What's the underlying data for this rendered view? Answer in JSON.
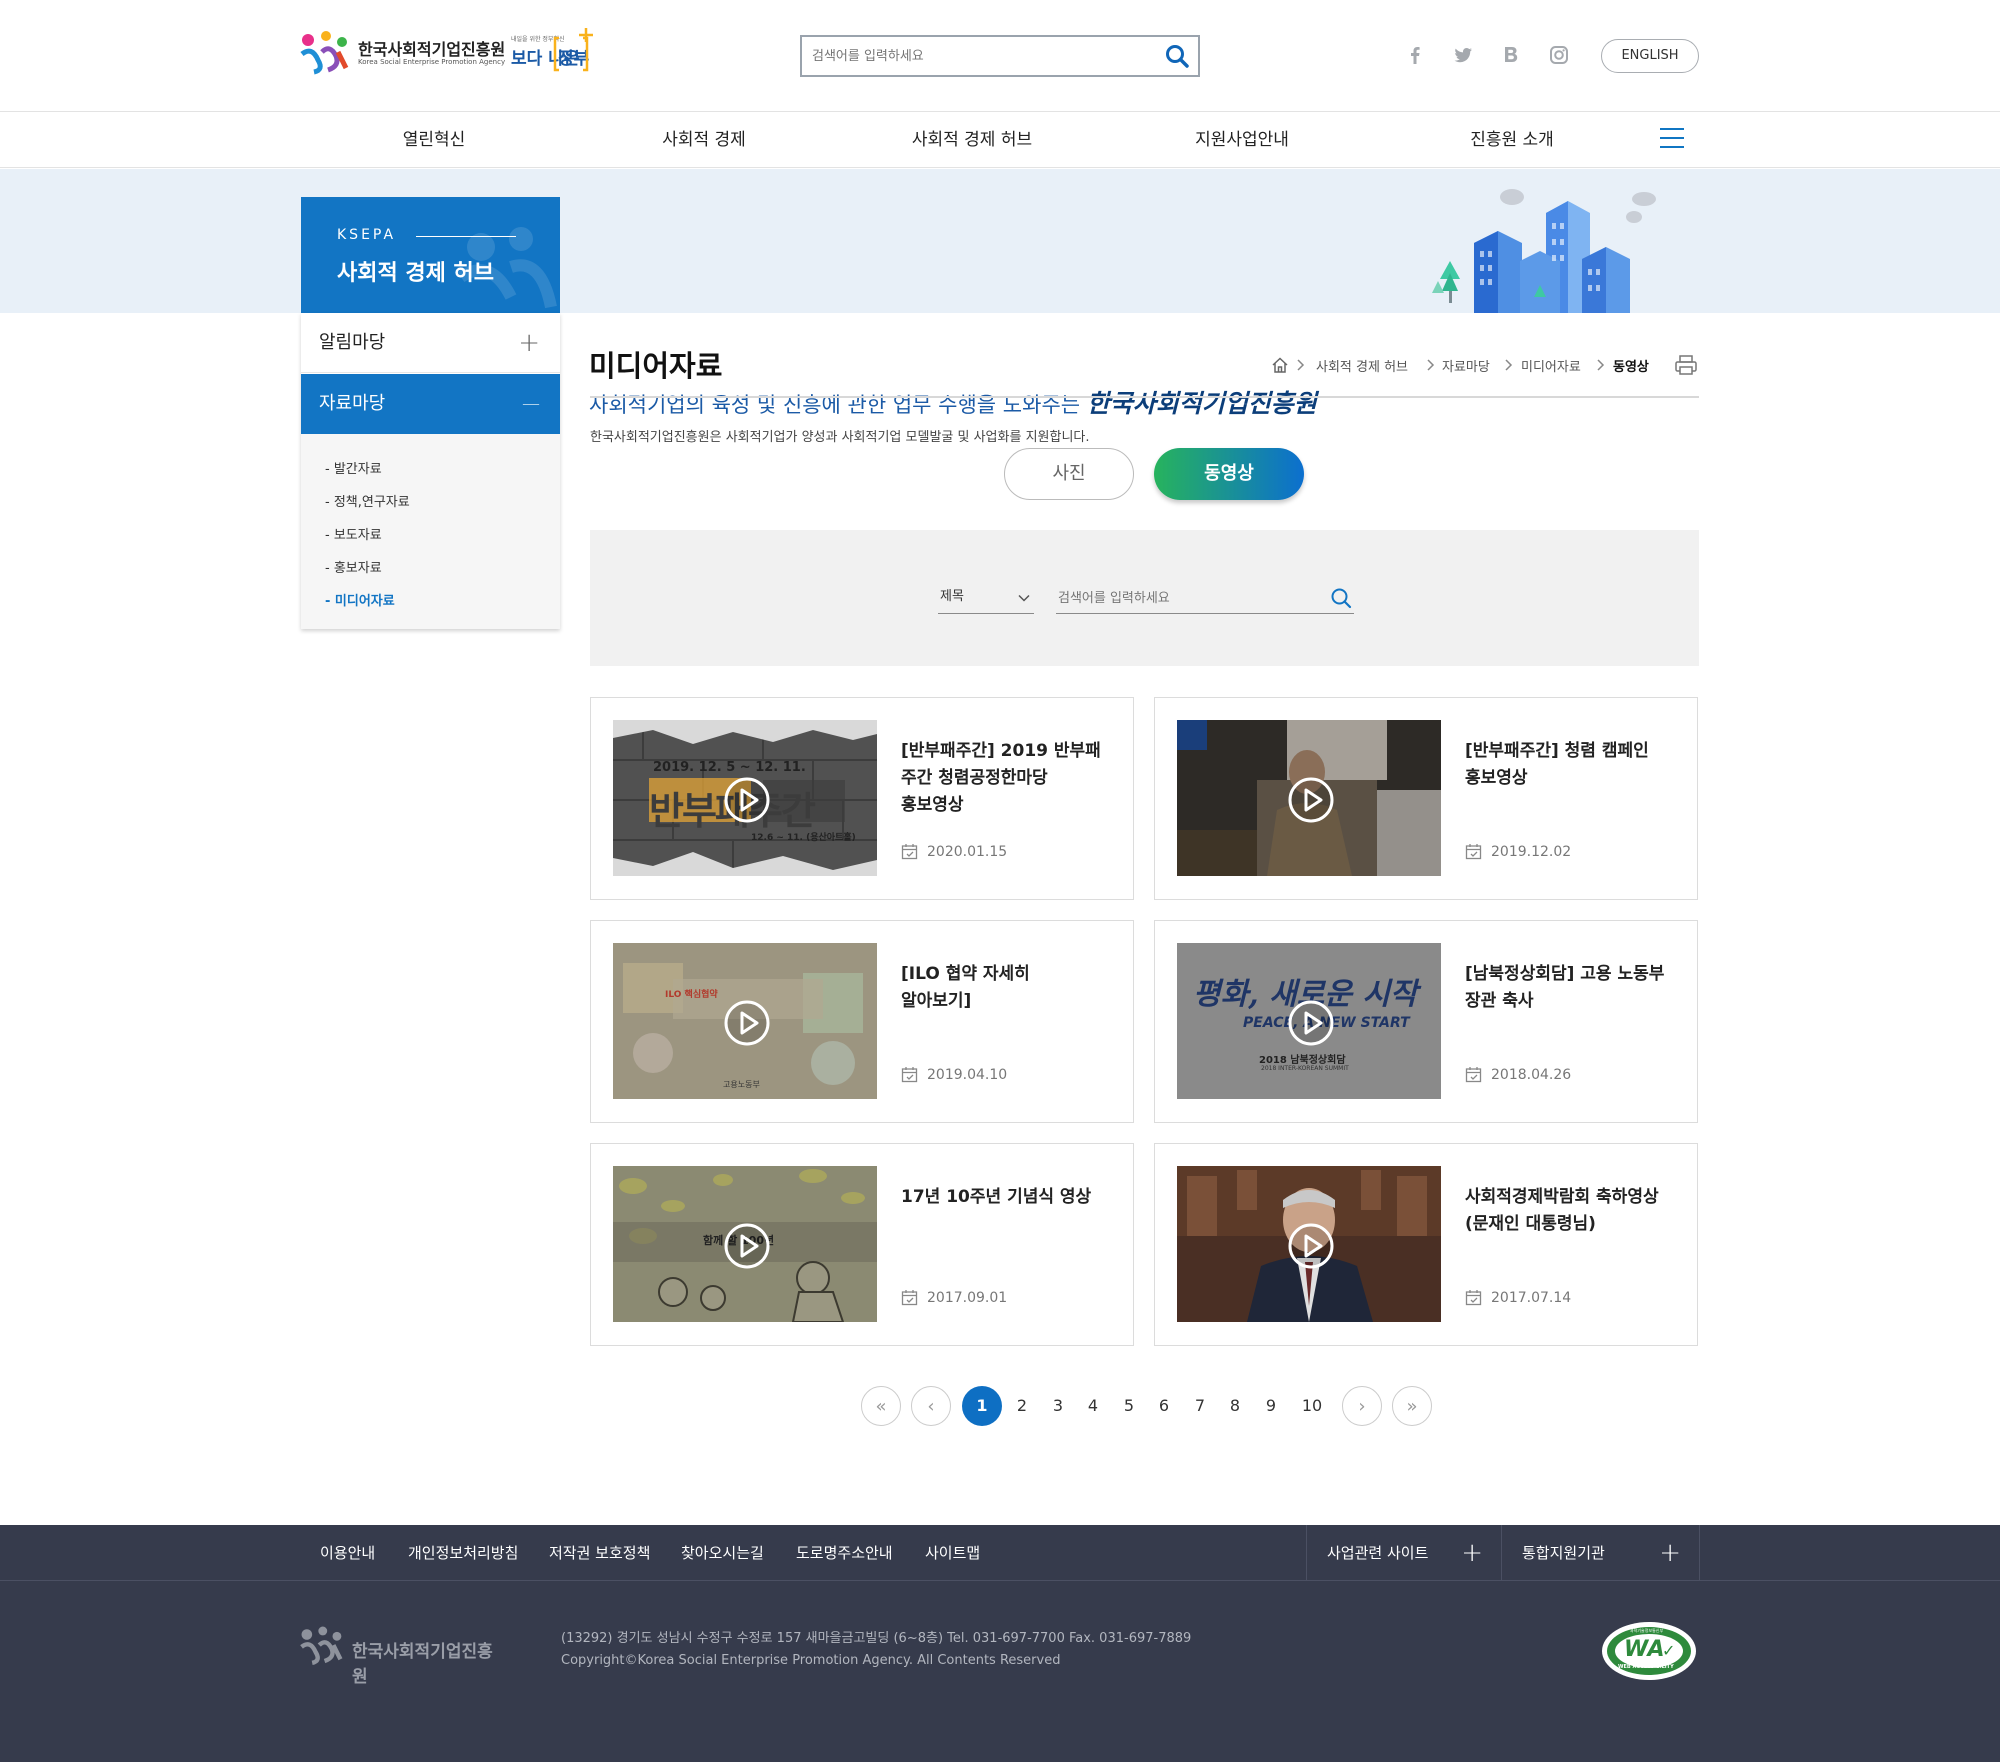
{
  "header": {
    "logo_name_kr": "한국사회적기업진흥원",
    "logo_name_en": "Korea Social Enterprise Promotion Agency",
    "gov_slogan_small": "내일을 위한 정부혁신",
    "gov_slogan_1": "보다 나은",
    "gov_slogan_2": "정부",
    "search_placeholder": "검색어를 입력하세요",
    "social": [
      "facebook-icon",
      "twitter-icon",
      "blog-icon",
      "instagram-icon"
    ],
    "english_label": "ENGLISH"
  },
  "gnb": [
    "열린혁신",
    "사회적 경제",
    "사회적 경제 허브",
    "지원사업안내",
    "진흥원 소개"
  ],
  "banner": {
    "side_label": "KSEPA",
    "side_title": "사회적 경제 허브",
    "headline": "사회적기업의 육성 및 진흥에 관한 업무 수행을 도와주는",
    "headline_strong": "한국사회적기업진흥원",
    "sub": "한국사회적기업진흥원은 사회적기업가 양성과 사회적기업 모델발굴 및 사업화를 지원합니다."
  },
  "sidemenu": {
    "top1": "알림마당",
    "top1_icon": "+",
    "top2": "자료마당",
    "top2_icon": "—",
    "sub": [
      "- 발간자료",
      "- 정책,연구자료",
      "- 보도자료",
      "- 홍보자료",
      "- 미디어자료"
    ],
    "active_sub_index": 4
  },
  "page": {
    "title": "미디어자료",
    "breadcrumb": [
      "사회적 경제 허브",
      "자료마당",
      "미디어자료",
      "동영상"
    ]
  },
  "tabs": {
    "photo": "사진",
    "video": "동영상",
    "active": "video"
  },
  "search": {
    "select_value": "제목",
    "placeholder": "검색어를 입력하세요"
  },
  "cards": [
    {
      "title": "[반부패주간] 2019 반부패 주간 청렴공정한마당 홍보영상",
      "date": "2020.01.15",
      "thumb_line1": "2019. 12. 5 ~ 12. 11.",
      "thumb_line2": "반부패주간",
      "thumb_line3": "12.6 ~ 11. (용산아트홀)"
    },
    {
      "title": "[반부패주간] 청렴 캠페인 홍보영상",
      "date": "2019.12.02"
    },
    {
      "title": "[ILO 협약 자세히 알아보기]",
      "date": "2019.04.10",
      "thumb_line1": "ILO 핵심협약",
      "thumb_line3": "고용노동부"
    },
    {
      "title": "[남북정상회담] 고용 노동부 장관 축사",
      "date": "2018.04.26",
      "thumb_line1": "평화, 새로운 시작",
      "thumb_line2": "PEACE, A NEW START",
      "thumb_line3": "2018 남북정상회담",
      "thumb_line4": "2018 INTER-KOREAN SUMMIT"
    },
    {
      "title": "17년 10주년 기념식 영상",
      "date": "2017.09.01",
      "thumb_line1": "함께 할 100년"
    },
    {
      "title": "사회적경제박람회 축하영상(문재인 대통령님)",
      "date": "2017.07.14"
    }
  ],
  "pagination": {
    "pages": [
      "1",
      "2",
      "3",
      "4",
      "5",
      "6",
      "7",
      "8",
      "9",
      "10"
    ],
    "current": "1",
    "first": "«",
    "prev": "‹",
    "next": "›",
    "last": "»"
  },
  "footer": {
    "links": [
      "이용안내",
      "개인정보처리방침",
      "저작권 보호정책",
      "찾아오시는길",
      "도로명주소안내",
      "사이트맵"
    ],
    "select1": "사업관련 사이트",
    "select2": "통합지원기관",
    "logo_text": "한국사회적기업진흥원",
    "address": "(13292) 경기도 성남시 수정구 수정로 157 새마을금고빌딩 (6~8층) Tel. 031-697-7700 Fax. 031-697-7889",
    "copyright": "Copyright©Korea Social Enterprise Promotion Agency. All Contents Reserved",
    "wa_text": "WA",
    "wa_sub": "WEB ACCESSIBILITY",
    "wa_top": "과학기술정보통신부"
  },
  "colors": {
    "accent": "#1275c4",
    "footer_bg": "#363b4c",
    "banner_bg": "#e8f0f8",
    "tab_gradient_start": "#27b35d",
    "tab_gradient_end": "#0c6fcf"
  }
}
